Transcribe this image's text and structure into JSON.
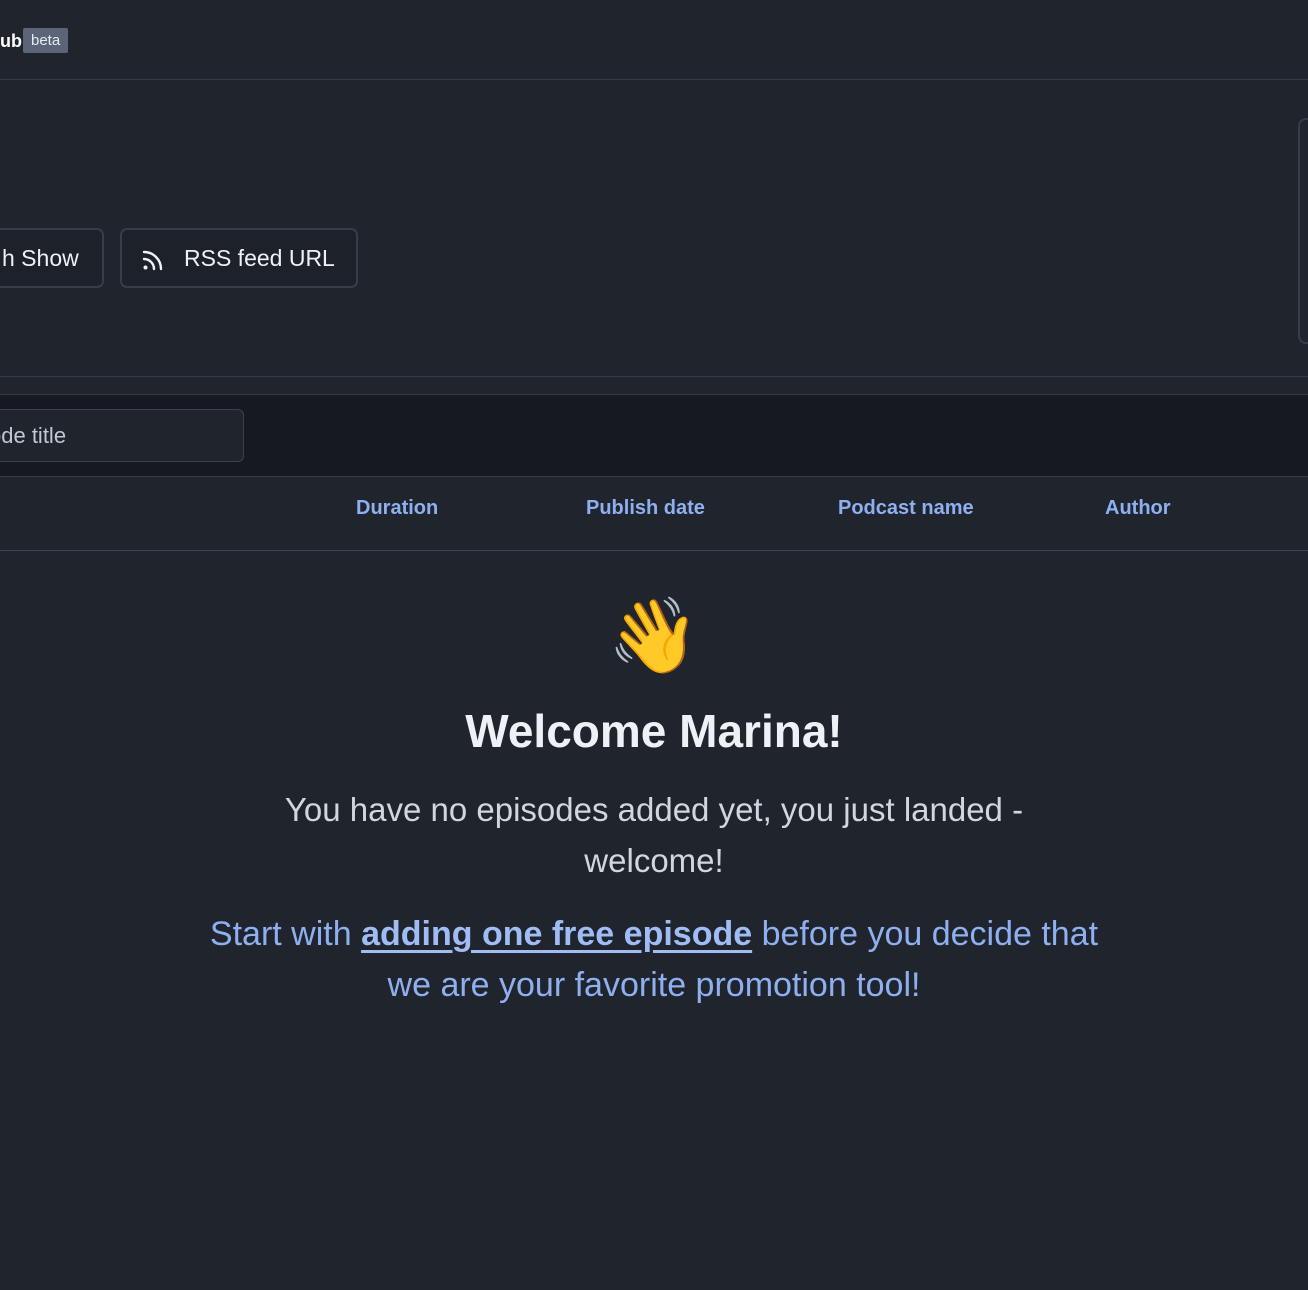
{
  "header": {
    "brand_fragment": "ub",
    "badge": "beta"
  },
  "actions": {
    "show_button_label": "h Show",
    "rss_button_label": "RSS feed URL",
    "rss_icon": "rss-icon"
  },
  "search": {
    "placeholder": "ode title"
  },
  "table": {
    "columns": [
      "Duration",
      "Publish date",
      "Podcast name",
      "Author"
    ]
  },
  "empty_state": {
    "emoji": "👋",
    "title": "Welcome Marina!",
    "message": "You have no episodes added yet, you just landed - welcome!",
    "cta_before": "Start with ",
    "cta_link": "adding one free episode",
    "cta_after": " before you decide that we are your favorite promotion tool!"
  },
  "colors": {
    "background": "#20242d",
    "accent": "#8fb0f0",
    "badge": "#5b6577"
  }
}
